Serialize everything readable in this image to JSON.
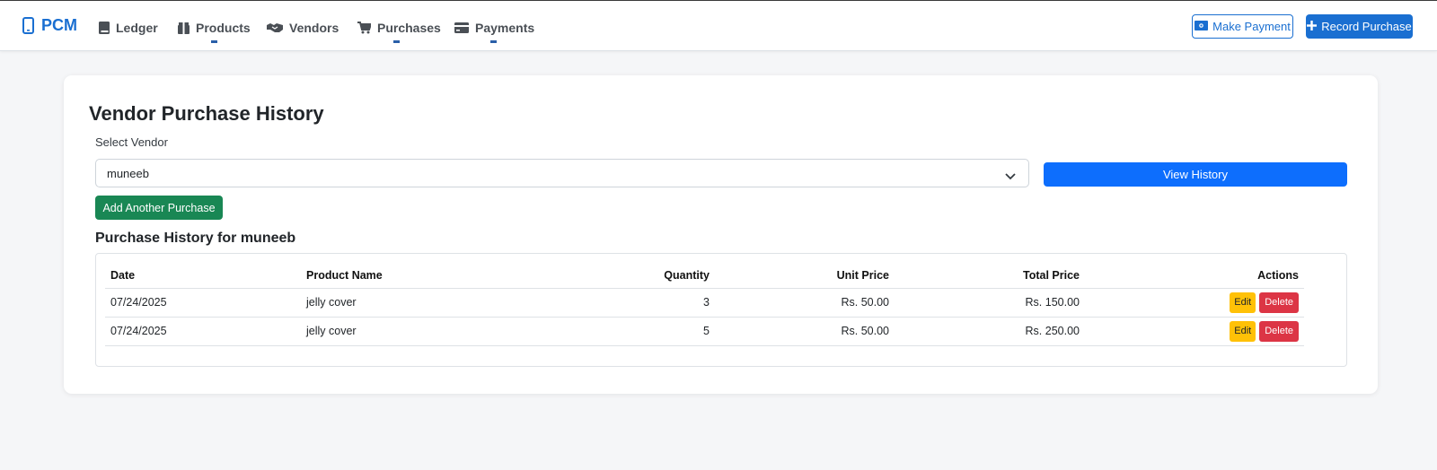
{
  "navbar": {
    "brand": "PCM",
    "items": [
      {
        "label": "Ledger",
        "icon": "book-icon"
      },
      {
        "label": "Products",
        "icon": "box-icon"
      },
      {
        "label": "Vendors",
        "icon": "handshake-icon"
      },
      {
        "label": "Purchases",
        "icon": "cart-icon"
      },
      {
        "label": "Payments",
        "icon": "credit-card-icon"
      }
    ],
    "make_payment_label": "Make Payment",
    "record_purchase_label": "Record Purchase"
  },
  "page": {
    "title": "Vendor Purchase History",
    "select_label": "Select Vendor",
    "selected_vendor": "muneeb",
    "view_history_label": "View History",
    "add_purchase_label": "Add Another Purchase",
    "history_title": "Purchase History for muneeb"
  },
  "table": {
    "headers": {
      "date": "Date",
      "product": "Product Name",
      "quantity": "Quantity",
      "unit_price": "Unit Price",
      "total_price": "Total Price",
      "actions": "Actions"
    },
    "rows": [
      {
        "date": "07/24/2025",
        "product": "jelly cover",
        "quantity": "3",
        "unit_price": "Rs. 50.00",
        "total_price": "Rs. 150.00",
        "edit": "Edit",
        "delete": "Delete"
      },
      {
        "date": "07/24/2025",
        "product": "jelly cover",
        "quantity": "5",
        "unit_price": "Rs. 50.00",
        "total_price": "Rs. 250.00",
        "edit": "Edit",
        "delete": "Delete"
      }
    ]
  },
  "colors": {
    "primary": "#0d6efd",
    "brand": "#1a6fd1",
    "success": "#198754",
    "warning": "#ffc107",
    "danger": "#dc3545"
  }
}
